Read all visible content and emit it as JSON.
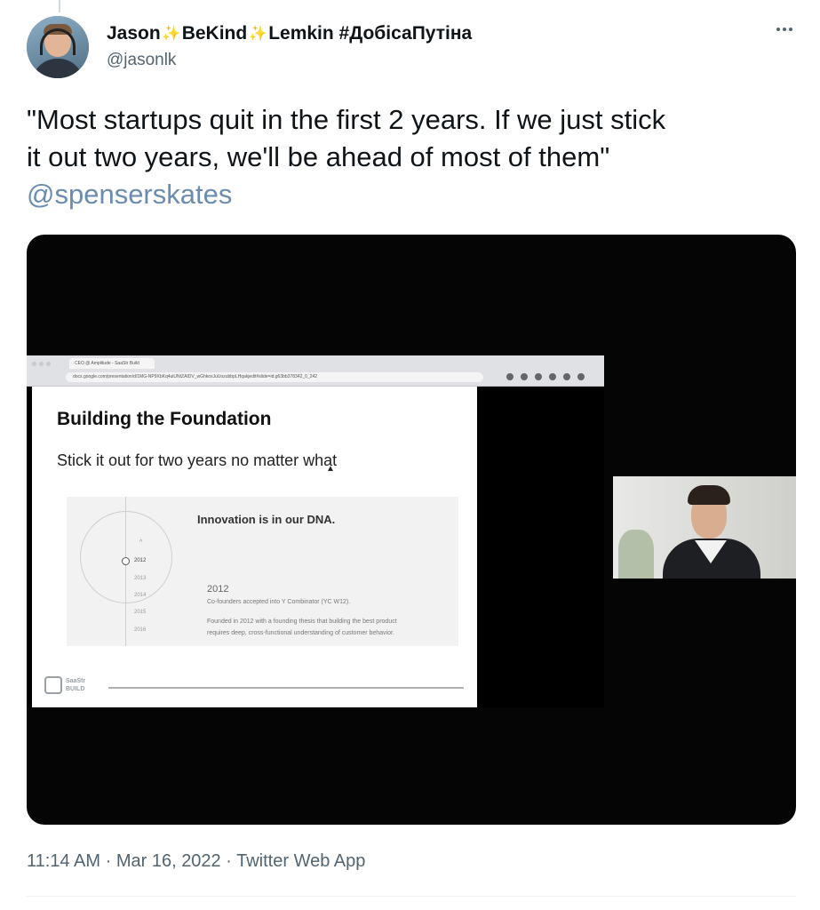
{
  "author": {
    "display_name_part1": "Jason",
    "display_name_part2": "BeKind",
    "display_name_part3": "Lemkin #ДобісаПутіна",
    "sparkle_glyph": "✨",
    "handle": "@jasonlk"
  },
  "tweet": {
    "line1": "\"Most startups quit in the first 2 years.  If we just stick",
    "line2": "it out two years, we'll be ahead of most of them\"",
    "mention": "@spenserskates",
    "mention_color": "#6b8bb0"
  },
  "video": {
    "browser_tab": "CEO @ Amplitude - SaaStr Build",
    "url": "docs.google.com/presentation/d/1MG-NP9XbKq4uiUNtZAIDV_wGhkoxJuUozubbpLHqakjedit#slide=id.g63bb378342_0_242",
    "slide": {
      "title": "Building the Foundation",
      "subtitle": "Stick it out for two years no matter what",
      "panel_heading": "Innovation is in our DNA.",
      "years": [
        "2012",
        "2013",
        "2014",
        "2015",
        "2016"
      ],
      "active_year": "2012",
      "detail_year": "2012",
      "detail_line1": "Co-founders accepted into Y Combinator (YC W12).",
      "detail_line2": "Founded in 2012 with a founding thesis that building the best product",
      "detail_line3": "requires deep, cross-functional understanding of customer behavior.",
      "logo_line1": "SaaStr",
      "logo_line2": "BUILD"
    }
  },
  "meta": {
    "time": "11:14 AM",
    "date": "Mar 16, 2022",
    "source": "Twitter Web App",
    "separator": "·"
  }
}
